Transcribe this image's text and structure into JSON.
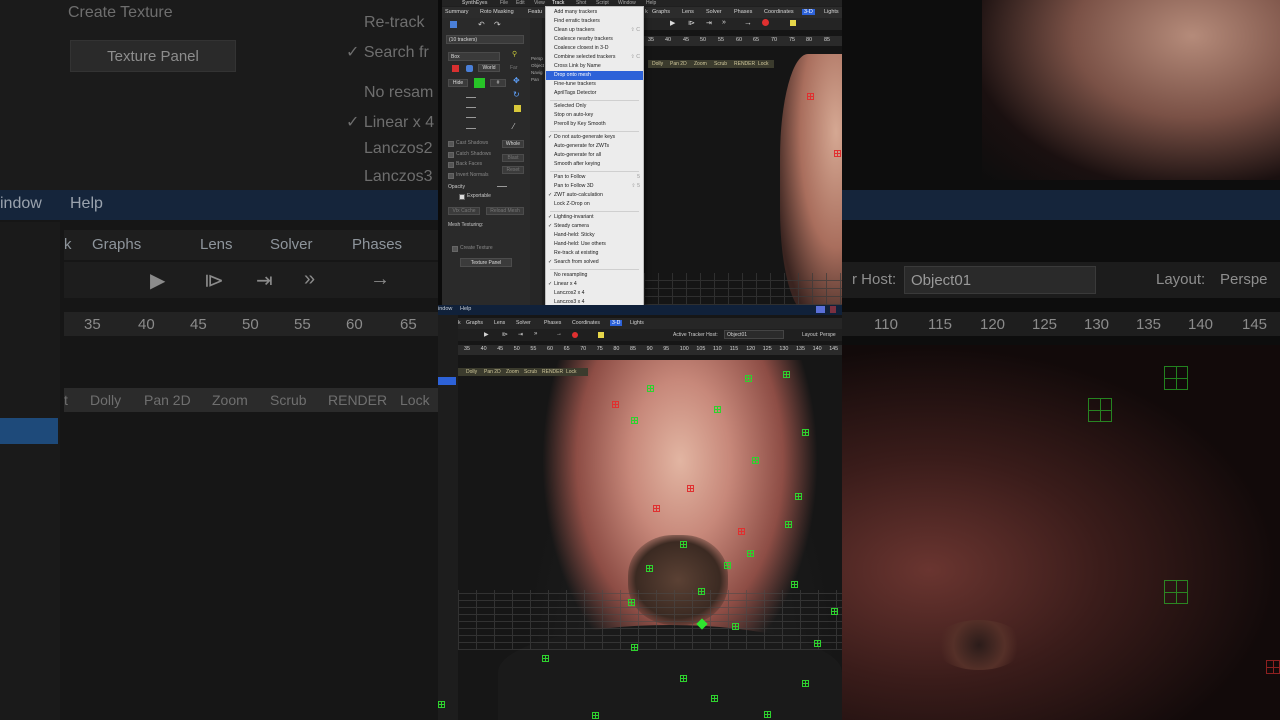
{
  "background_left": {
    "top_menu": [
      "Create Texture",
      "Texture Panel",
      "Re-track",
      "✓ Search fr",
      "No resam",
      "✓ Linear x 4",
      "Lanczos2",
      "Lanczos3"
    ],
    "menu": [
      "indow",
      "Help"
    ],
    "tabs": [
      "k",
      "Graphs",
      "Lens",
      "Solver",
      "Phases"
    ],
    "ruler": [
      "35",
      "40",
      "45",
      "50",
      "55",
      "60",
      "65"
    ],
    "viewbar": [
      "t",
      "Dolly",
      "Pan 2D",
      "Zoom",
      "Scrub",
      "RENDER",
      "Lock"
    ]
  },
  "background_right": {
    "host_label": "r Host:",
    "host_value": "Object01",
    "layout_label": "Layout:",
    "layout_value": "Perspe",
    "ruler": [
      "110",
      "115",
      "120",
      "125",
      "130",
      "135",
      "140",
      "145"
    ]
  },
  "app_top": {
    "menubar": [
      "SynthEyes",
      "File",
      "Edit",
      "View",
      "Track",
      "Shot",
      "Script",
      "Window",
      "Help"
    ],
    "tabs": [
      "Summary",
      "Roto Masking",
      "Featu",
      "k",
      "Graphs",
      "Lens",
      "Solver",
      "Phases",
      "Coordinates",
      "3-D",
      "Lights"
    ],
    "tracker_select": "(10 trackers)",
    "shape_select": "Box",
    "world_label": "World",
    "far_label": "Far",
    "hide_label": "Hide",
    "hash_label": "#",
    "checkboxes": [
      "Cast Shadows",
      "Catch Shadows",
      "Back Faces",
      "Invert Normals"
    ],
    "whole_button": "Whole",
    "blast_button": "Blast",
    "reset_button": "Reset",
    "opacity_label": "Opacity",
    "exportable_label": "Exportable",
    "vtx_cache_button": "Vtx Cache",
    "reload_mesh_button": "Reload Mesh",
    "mesh_texturing_label": "Mesh Texturing:",
    "create_texture_label": "Create Texture",
    "texture_panel_button": "Texture Panel",
    "mid_labels": [
      "Persp",
      "Object",
      "Navig",
      "Pan"
    ],
    "ruler": [
      "35",
      "40",
      "45",
      "50",
      "55",
      "60",
      "65",
      "70",
      "75",
      "80",
      "85"
    ],
    "viewbar": [
      "Dolly",
      "Pan 2D",
      "Zoom",
      "Scrub",
      "RENDER",
      "Lock"
    ]
  },
  "dropdown": {
    "items": [
      {
        "label": "Add many trackers",
        "check": "",
        "shortcut": ""
      },
      {
        "label": "Find erratic trackers",
        "check": "",
        "shortcut": ""
      },
      {
        "label": "Clean up trackers",
        "check": "",
        "shortcut": "⇧ C"
      },
      {
        "label": "Coalesce nearby trackers",
        "check": "",
        "shortcut": ""
      },
      {
        "label": "Coalesce closest in 3-D",
        "check": "",
        "shortcut": ""
      },
      {
        "label": "Combine selected trackers",
        "check": "",
        "shortcut": "⇧ C"
      },
      {
        "label": "Cross Link by Name",
        "check": "",
        "shortcut": ""
      },
      {
        "label": "Drop onto mesh",
        "check": "",
        "shortcut": "",
        "highlight": true
      },
      {
        "label": "Fine-tune trackers",
        "check": "",
        "shortcut": ""
      },
      {
        "label": "AprilTags Detector",
        "check": "",
        "shortcut": ""
      },
      {
        "sep": true
      },
      {
        "label": "Selected Only",
        "check": "",
        "shortcut": ""
      },
      {
        "label": "Stop on auto-key",
        "check": "",
        "shortcut": ""
      },
      {
        "label": "Preroll by Key Smooth",
        "check": "",
        "shortcut": ""
      },
      {
        "sep": true
      },
      {
        "label": "Do not auto-generate keys",
        "check": "✓",
        "shortcut": ""
      },
      {
        "label": "Auto-generate for ZWTs",
        "check": "",
        "shortcut": ""
      },
      {
        "label": "Auto-generate for all",
        "check": "",
        "shortcut": ""
      },
      {
        "label": "Smooth after keying",
        "check": "",
        "shortcut": ""
      },
      {
        "sep": true
      },
      {
        "label": "Pan to Follow",
        "check": "",
        "shortcut": "5"
      },
      {
        "label": "Pan to Follow 3D",
        "check": "",
        "shortcut": "⇧ 5"
      },
      {
        "label": "ZWT auto-calculation",
        "check": "✓",
        "shortcut": ""
      },
      {
        "label": "Lock Z-Drop on",
        "check": "",
        "shortcut": ""
      },
      {
        "sep": true
      },
      {
        "label": "Lighting-invariant",
        "check": "✓",
        "shortcut": ""
      },
      {
        "label": "Steady camera",
        "check": "✓",
        "shortcut": ""
      },
      {
        "label": "Hand-held: Sticky",
        "check": "",
        "shortcut": ""
      },
      {
        "label": "Hand-held: Use others",
        "check": "",
        "shortcut": ""
      },
      {
        "label": "Re-track at existing",
        "check": "",
        "shortcut": ""
      },
      {
        "label": "Search from solved",
        "check": "✓",
        "shortcut": ""
      },
      {
        "sep": true
      },
      {
        "label": "No resampling",
        "check": "",
        "shortcut": ""
      },
      {
        "label": "Linear x 4",
        "check": "✓",
        "shortcut": ""
      },
      {
        "label": "Lanczos2 x 4",
        "check": "",
        "shortcut": ""
      },
      {
        "label": "Lanczos3 x 4",
        "check": "",
        "shortcut": ""
      }
    ]
  },
  "app_bottom": {
    "menubar": [
      "indow",
      "Help"
    ],
    "tabs": [
      "k",
      "Graphs",
      "Lens",
      "Solver",
      "Phases",
      "Coordinates",
      "3-D",
      "Lights"
    ],
    "host_label": "Active Tracker Host:",
    "host_value": "Object01",
    "layout_label": "Layout:",
    "layout_value": "Perspe",
    "ruler": [
      "35",
      "40",
      "45",
      "50",
      "55",
      "60",
      "65",
      "70",
      "75",
      "80",
      "85",
      "90",
      "95",
      "100",
      "105",
      "110",
      "115",
      "120",
      "125",
      "130",
      "135",
      "140",
      "145"
    ],
    "viewbar": [
      "Dolly",
      "Pan 2D",
      "Zoom",
      "Scrub",
      "RENDER",
      "Lock"
    ]
  },
  "colors": {
    "tracker_green": "#2ed22e",
    "tracker_red": "#e03030",
    "menu_highlight": "#2d62d8"
  }
}
